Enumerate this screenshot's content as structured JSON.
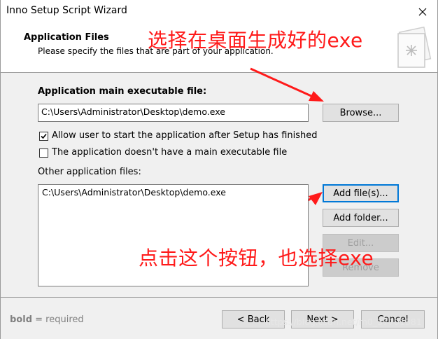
{
  "window": {
    "title": "Inno Setup Script Wizard"
  },
  "header": {
    "title": "Application Files",
    "subtitle": "Please specify the files that are part of your application.",
    "icon": "wizard-document-icon"
  },
  "annotations": {
    "top": "选择在桌面生成好的exe",
    "bottom": "点击这个按钮，也选择exe",
    "color": "#ff1a1a"
  },
  "main": {
    "main_exe_label": "Application main executable file:",
    "main_exe_value": "C:\\Users\\Administrator\\Desktop\\demo.exe",
    "browse_label": "Browse...",
    "allow_start_label": "Allow user to start the application after Setup has finished",
    "allow_start_checked": true,
    "no_main_exe_label": "The application doesn't have a main executable file",
    "no_main_exe_checked": false,
    "other_files_label": "Other application files:",
    "other_files": [
      "C:\\Users\\Administrator\\Desktop\\demo.exe"
    ],
    "add_files_label": "Add file(s)...",
    "add_folder_label": "Add folder...",
    "edit_label": "Edit...",
    "remove_label": "Remove"
  },
  "footer": {
    "note_bold": "bold",
    "note_rest": " = required",
    "back_label": "< Back",
    "next_label": "Next >",
    "cancel_label": "Cancel",
    "watermark": "https://blog.csdn.net/m0_37701381"
  },
  "colors": {
    "accent": "#0078d7"
  }
}
